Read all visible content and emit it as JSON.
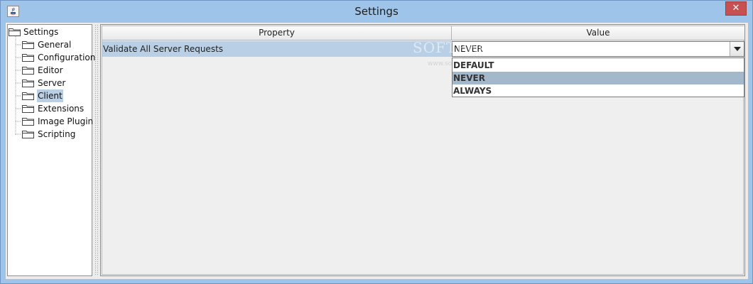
{
  "window": {
    "title": "Settings",
    "close_label": "✕"
  },
  "tree": {
    "root": "Settings",
    "items": [
      {
        "label": "General"
      },
      {
        "label": "Configuration"
      },
      {
        "label": "Editor"
      },
      {
        "label": "Server"
      },
      {
        "label": "Client"
      },
      {
        "label": "Extensions"
      },
      {
        "label": "Image Plugin"
      },
      {
        "label": "Scripting"
      }
    ],
    "selected": "Client"
  },
  "table": {
    "headers": {
      "property": "Property",
      "value": "Value"
    },
    "rows": [
      {
        "property": "Validate All Server Requests",
        "value": "NEVER"
      }
    ]
  },
  "dropdown": {
    "options": [
      "DEFAULT",
      "NEVER",
      "ALWAYS"
    ],
    "selected": "NEVER"
  },
  "watermark": {
    "text": "SOFTPEDIA",
    "sub": "www.softpedia.com"
  },
  "colors": {
    "titlebar": "#9fc4ea",
    "close_button": "#c75050",
    "selection": "#b8cfe5",
    "dropdown_selection": "#a4b8cc"
  }
}
